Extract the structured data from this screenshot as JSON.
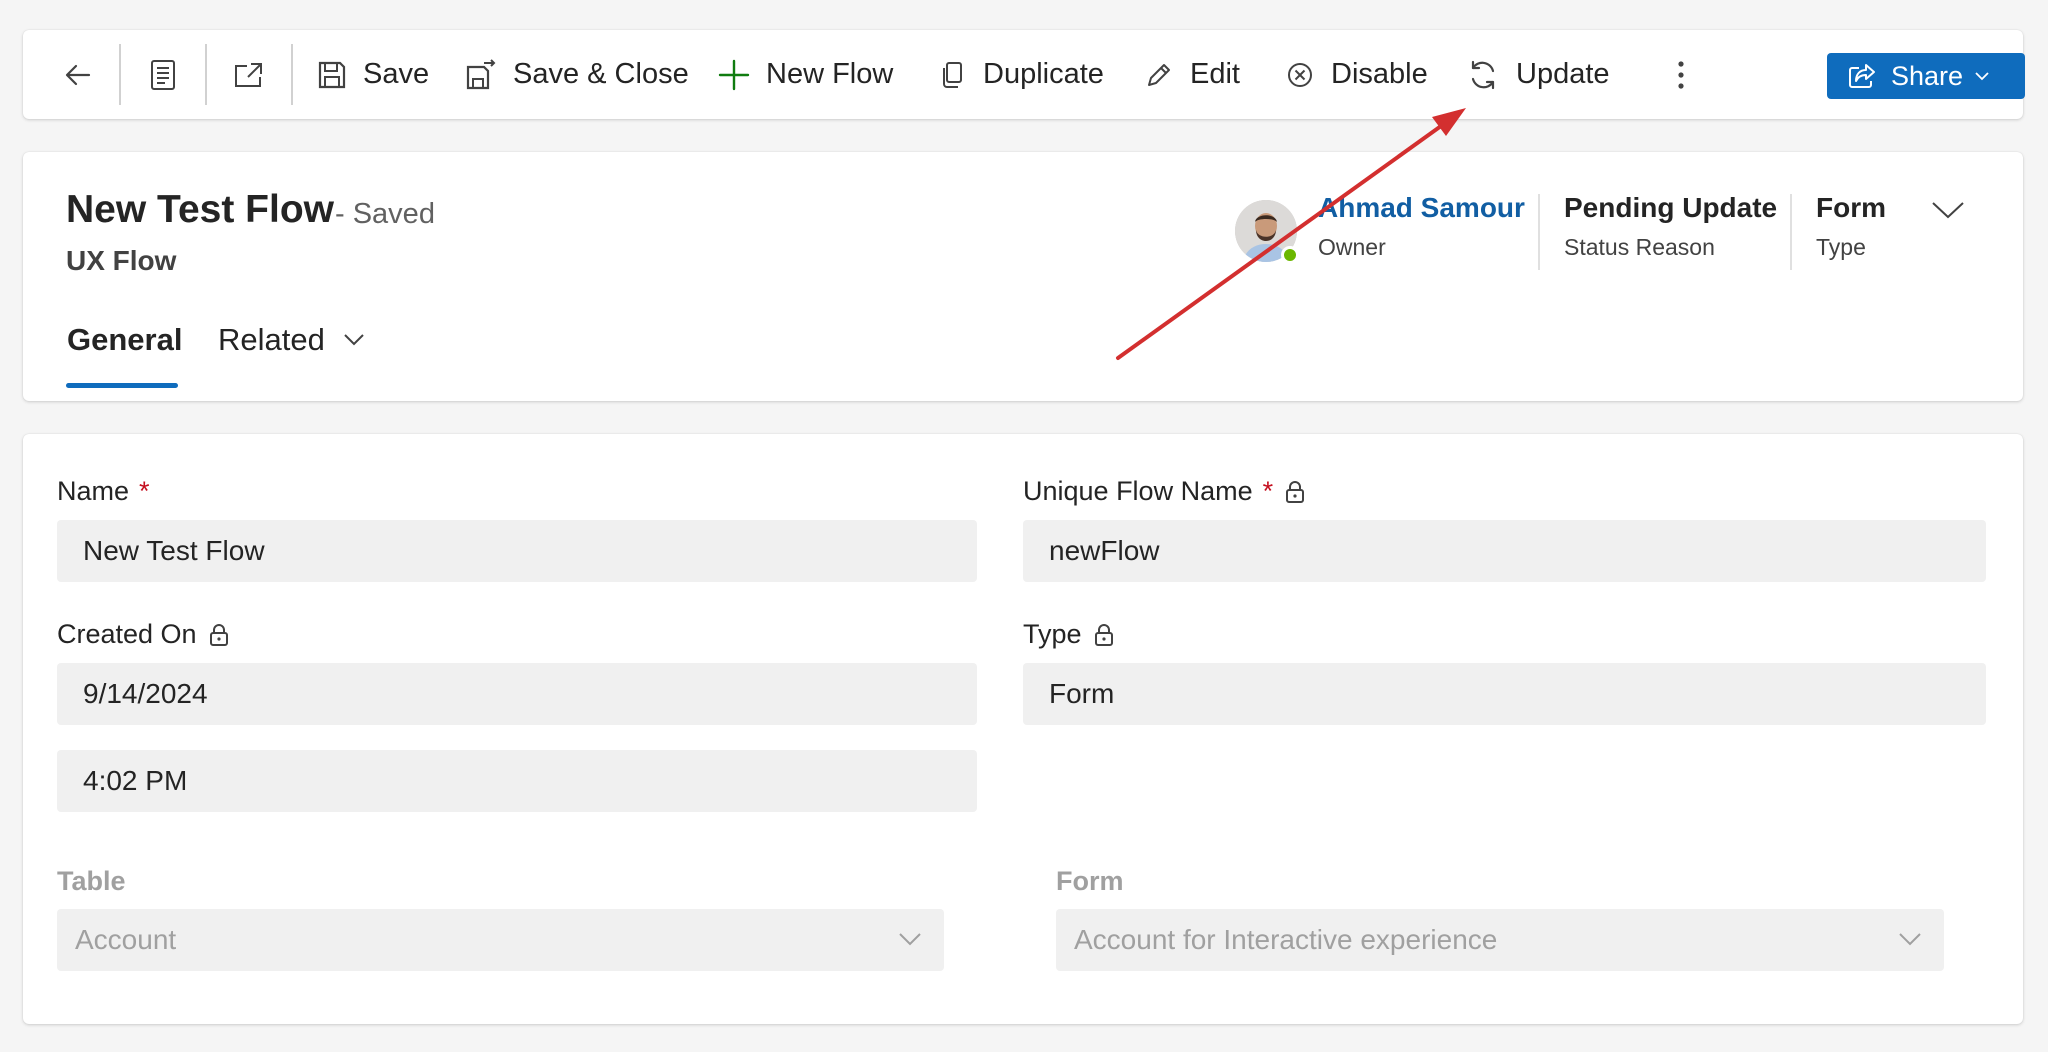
{
  "commandbar": {
    "back_icon": "arrow-left-icon",
    "form_icon": "form-document-icon",
    "popout_icon": "open-in-new-window-icon",
    "save_label": "Save",
    "save_close_label": "Save & Close",
    "new_flow_label": "New Flow",
    "duplicate_label": "Duplicate",
    "edit_label": "Edit",
    "disable_label": "Disable",
    "update_label": "Update",
    "more_icon": "more-vertical-icon",
    "share_label": "Share",
    "share_color": "#0f6cbd",
    "new_flow_icon_color": "#107c10"
  },
  "header": {
    "title": "New Test Flow",
    "save_status": "- Saved",
    "entity": "UX Flow",
    "owner": {
      "name": "Ahmad Samour",
      "label": "Owner",
      "presence": "available"
    },
    "status_reason": {
      "value": "Pending Update",
      "label": "Status Reason"
    },
    "type": {
      "value": "Form",
      "label": "Type"
    },
    "tabs": [
      {
        "label": "General",
        "selected": true
      },
      {
        "label": "Related",
        "selected": false
      }
    ]
  },
  "form": {
    "name": {
      "label": "Name",
      "required_mark": "*",
      "value": "New Test Flow"
    },
    "unique_name": {
      "label": "Unique Flow Name",
      "required_mark": "*",
      "locked": true,
      "value": "newFlow"
    },
    "created_on": {
      "label": "Created On",
      "locked": true,
      "date": "9/14/2024",
      "time": "4:02 PM"
    },
    "type": {
      "label": "Type",
      "locked": true,
      "value": "Form"
    },
    "table": {
      "label": "Table",
      "value": "Account",
      "disabled": true
    },
    "form_select": {
      "label": "Form",
      "value": "Account for Interactive experience",
      "disabled": true
    }
  },
  "annotation": {
    "arrow_color": "#d32f2f",
    "points_to": "update-button"
  }
}
